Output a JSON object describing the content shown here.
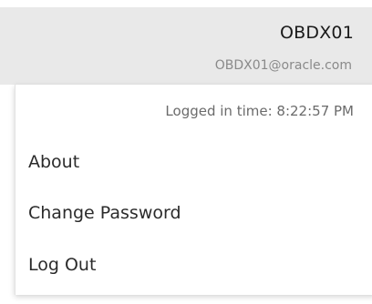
{
  "user": {
    "name": "OBDX01",
    "email": "OBDX01@oracle.com"
  },
  "menu": {
    "logged_in_text": "Logged in time: 8:22:57 PM",
    "items": [
      {
        "label": "About"
      },
      {
        "label": "Change Password"
      },
      {
        "label": "Log Out"
      }
    ]
  },
  "colors": {
    "header_background": "#e9e9e9",
    "menu_background": "#ffffff",
    "primary_text": "#2b2b2b",
    "secondary_text": "#8a8a8a"
  }
}
